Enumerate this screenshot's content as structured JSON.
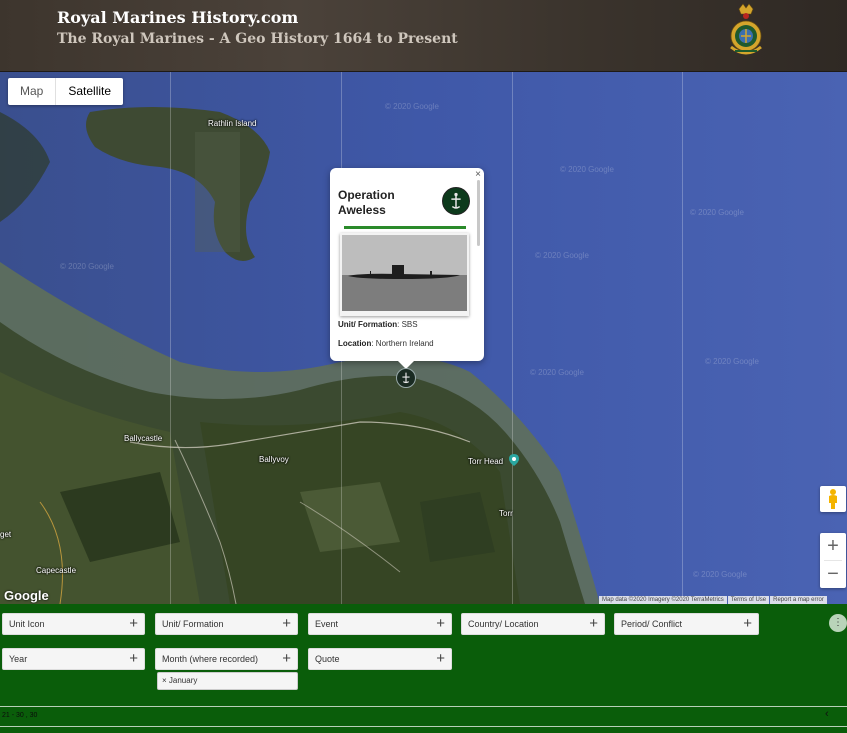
{
  "header": {
    "site_title": "Royal Marines History.com",
    "site_subtitle": "The Royal Marines - A Geo History 1664 to Present"
  },
  "map": {
    "type_buttons": [
      "Map",
      "Satellite"
    ],
    "active_type": "Satellite",
    "labels": {
      "rathlin": "Rathlin Island",
      "ballycastle": "Ballycastle",
      "ballyvoy": "Ballyvoy",
      "torr_head": "Torr Head",
      "torr": "Torr",
      "capecastle": "Capecastle",
      "get": "get"
    },
    "watermark": "© 2020 Google",
    "logo": "Google",
    "footer": [
      "Map data ©2020 Imagery ©2020 TerraMetrics",
      "Terms of Use",
      "Report a map error"
    ],
    "zoom_in": "+",
    "zoom_out": "−"
  },
  "info_window": {
    "close": "×",
    "title": "Operation Aweless",
    "unit_label": "Unit/ Formation",
    "unit_value": "SBS",
    "location_label": "Location",
    "location_value": "Northern Ireland"
  },
  "filters": {
    "row1": [
      "Unit Icon",
      "Unit/ Formation",
      "Event",
      "Country/ Location",
      "Period/ Conflict"
    ],
    "row2": [
      "Year",
      "Month (where recorded)",
      "Quote"
    ],
    "plus": "+",
    "selected_tag": "January",
    "tag_remove": "×",
    "more": "⋮",
    "pager": "21 - 30 , 30",
    "pager_arrow": "‹"
  },
  "colors": {
    "header_bg": "#3d352d",
    "filter_bg": "#0a5d0a",
    "water": "#3f58a8",
    "accent_green": "#2a8a2a"
  }
}
